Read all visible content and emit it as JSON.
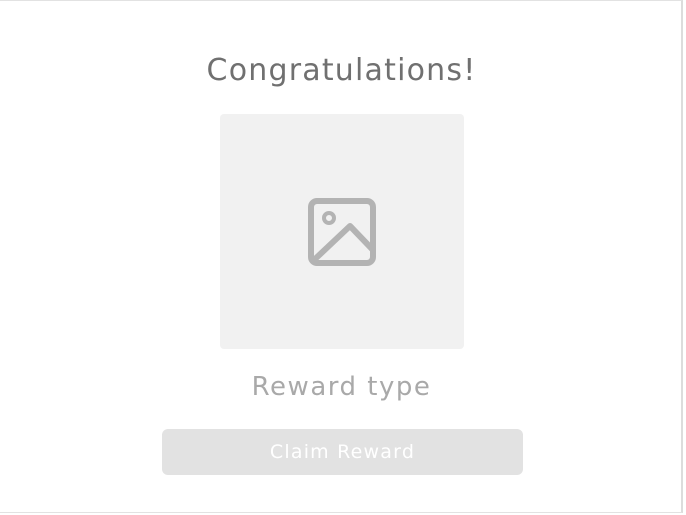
{
  "reward_card": {
    "title": "Congratulations!",
    "image": {
      "icon": "image-placeholder-icon"
    },
    "reward_type": "Reward type",
    "claim_button_label": "Claim Reward"
  },
  "colors": {
    "title_text": "#707070",
    "image_background": "#f1f1f1",
    "icon_stroke": "#b3b3b3",
    "subtitle_text": "#a9a9a9",
    "button_background": "#e2e2e2",
    "button_text": "#ffffff"
  }
}
